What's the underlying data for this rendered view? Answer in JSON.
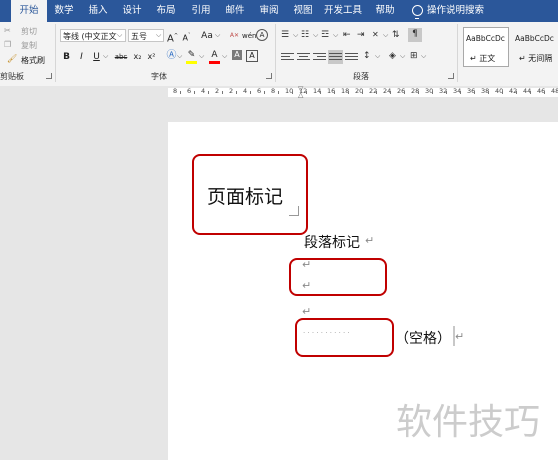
{
  "tabs": [
    "开始",
    "数学",
    "插入",
    "设计",
    "布局",
    "引用",
    "邮件",
    "审阅",
    "视图",
    "开发工具",
    "帮助"
  ],
  "tell_me": "操作说明搜索",
  "clipboard": {
    "cut": "剪切",
    "copy": "复制",
    "format_painter": "格式刷",
    "group_label": "剪贴板"
  },
  "font": {
    "font_name": "等线 (中文正文",
    "font_size": "五号",
    "group_label": "字体",
    "grow": "A",
    "shrink": "A",
    "case": "Aa",
    "phonetic": "wén",
    "enclose": "A",
    "bold": "B",
    "italic": "I",
    "underline": "U",
    "strikethrough": "abc",
    "subscript": "x₂",
    "superscript": "x²"
  },
  "paragraph": {
    "group_label": "段落"
  },
  "styles": [
    {
      "preview": "AaBbCcDc",
      "name": "↵ 正文"
    },
    {
      "preview": "AaBbCcDc",
      "name": "↵ 无间隔"
    }
  ],
  "document": {
    "box_label": "页面标记",
    "paragraph_text": "段落标记",
    "space_label": "（空格）",
    "space_dots": "· · · · · · · · · · ·",
    "para_mark": "↵"
  },
  "watermark": "软件技巧",
  "ruler_numbers": [
    "8",
    "6",
    "4",
    "2",
    "2",
    "4",
    "6",
    "8",
    "10",
    "12",
    "14",
    "16",
    "18",
    "20",
    "22",
    "24",
    "26",
    "28",
    "30",
    "32",
    "34",
    "36",
    "38",
    "40",
    "42",
    "44",
    "46",
    "48"
  ],
  "colors": {
    "brand": "#2b579a",
    "highlight": "#c00000",
    "font_color_bar": "#ff0000",
    "highlight_bar": "#ffff00"
  }
}
